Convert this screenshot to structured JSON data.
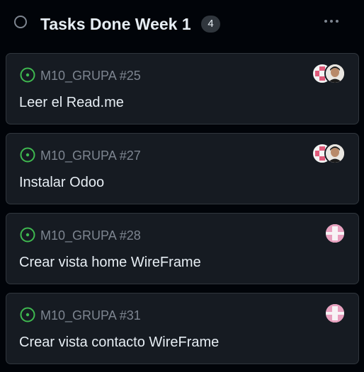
{
  "column": {
    "title": "Tasks Done Week 1",
    "count": "4",
    "status_icon": "circle-outline-icon",
    "menu_icon": "kebab-horizontal-icon"
  },
  "cards": [
    {
      "ref": "M10_GRUPA #25",
      "title": "Leer el Read.me",
      "status_icon": "issue-open-icon",
      "avatars": [
        "identicon-avatar",
        "user-photo-avatar"
      ]
    },
    {
      "ref": "M10_GRUPA #27",
      "title": "Instalar Odoo",
      "status_icon": "issue-open-icon",
      "avatars": [
        "identicon-avatar",
        "user-photo-avatar"
      ]
    },
    {
      "ref": "M10_GRUPA #28",
      "title": "Crear vista home WireFrame",
      "status_icon": "issue-open-icon",
      "avatars": [
        "identicon-avatar"
      ]
    },
    {
      "ref": "M10_GRUPA #31",
      "title": "Crear vista contacto WireFrame",
      "status_icon": "issue-open-icon",
      "avatars": [
        "identicon-avatar"
      ]
    }
  ],
  "colors": {
    "background": "#010409",
    "card": "#161b22",
    "border": "#30363d",
    "open_issue": "#3fb950",
    "muted_text": "#7d8590",
    "text": "#e6edf3",
    "identicon": "#e8a0bf"
  }
}
